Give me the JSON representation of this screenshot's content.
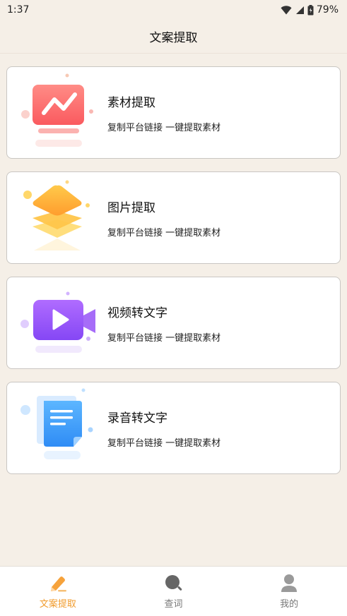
{
  "status_bar": {
    "time": "1:37",
    "battery": "79%"
  },
  "header": {
    "title": "文案提取"
  },
  "cards": [
    {
      "title": "素材提取",
      "desc": "复制平台链接 一键提取素材",
      "icon": "chart-monitor-icon"
    },
    {
      "title": "图片提取",
      "desc": "复制平台链接 一键提取素材",
      "icon": "layers-icon"
    },
    {
      "title": "视频转文字",
      "desc": "复制平台链接 一键提取素材",
      "icon": "video-camera-icon"
    },
    {
      "title": "录音转文字",
      "desc": "复制平台链接 一键提取素材",
      "icon": "document-icon"
    }
  ],
  "bottom_nav": {
    "items": [
      {
        "label": "文案提取",
        "icon": "pencil-icon",
        "active": true
      },
      {
        "label": "查词",
        "icon": "search-icon",
        "active": false
      },
      {
        "label": "我的",
        "icon": "user-icon",
        "active": false
      }
    ]
  },
  "colors": {
    "accent": "#f19b2c",
    "background": "#f5efe7"
  }
}
